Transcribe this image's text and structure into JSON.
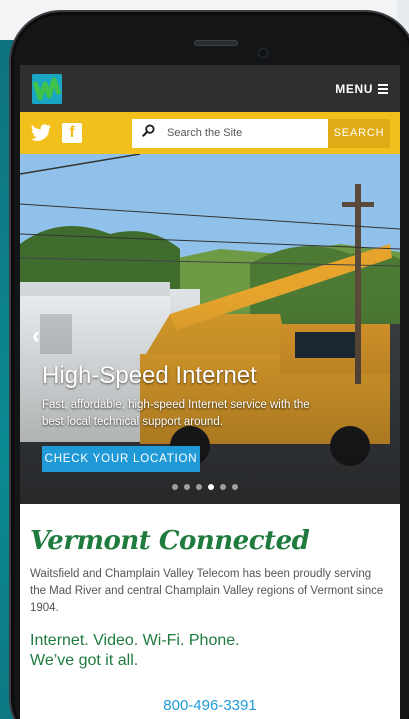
{
  "topbar": {
    "menu_label": "MENU"
  },
  "search": {
    "placeholder": "Search the Site",
    "button_label": "SEARCH"
  },
  "hero": {
    "title": "High-Speed Internet",
    "subtitle": "Fast, affordable, high-speed Internet service with the best local technical support around.",
    "cta_label": "CHECK YOUR LOCATION",
    "slide_count": 6,
    "active_slide": 4
  },
  "content": {
    "headline": "Vermont Connected",
    "body": "Waitsfield and Champlain Valley Telecom has been proudly serving the Mad River and central Champlain Valley regions of Vermont since 1904.",
    "tagline_line1": "Internet. Video. Wi-Fi. Phone.",
    "tagline_line2": "We’ve got it all.",
    "phone": "800-496-3391"
  },
  "colors": {
    "accent_yellow": "#f2c01d",
    "brand_green": "#1f7b3e",
    "link_blue": "#1f9ad6",
    "topbar_dark": "#2f2f2f"
  },
  "icons": {
    "logo": "logo-icon",
    "menu": "menu-icon",
    "twitter": "twitter-icon",
    "facebook": "facebook-icon",
    "search": "search-icon",
    "carousel_prev": "chevron-left-icon"
  }
}
